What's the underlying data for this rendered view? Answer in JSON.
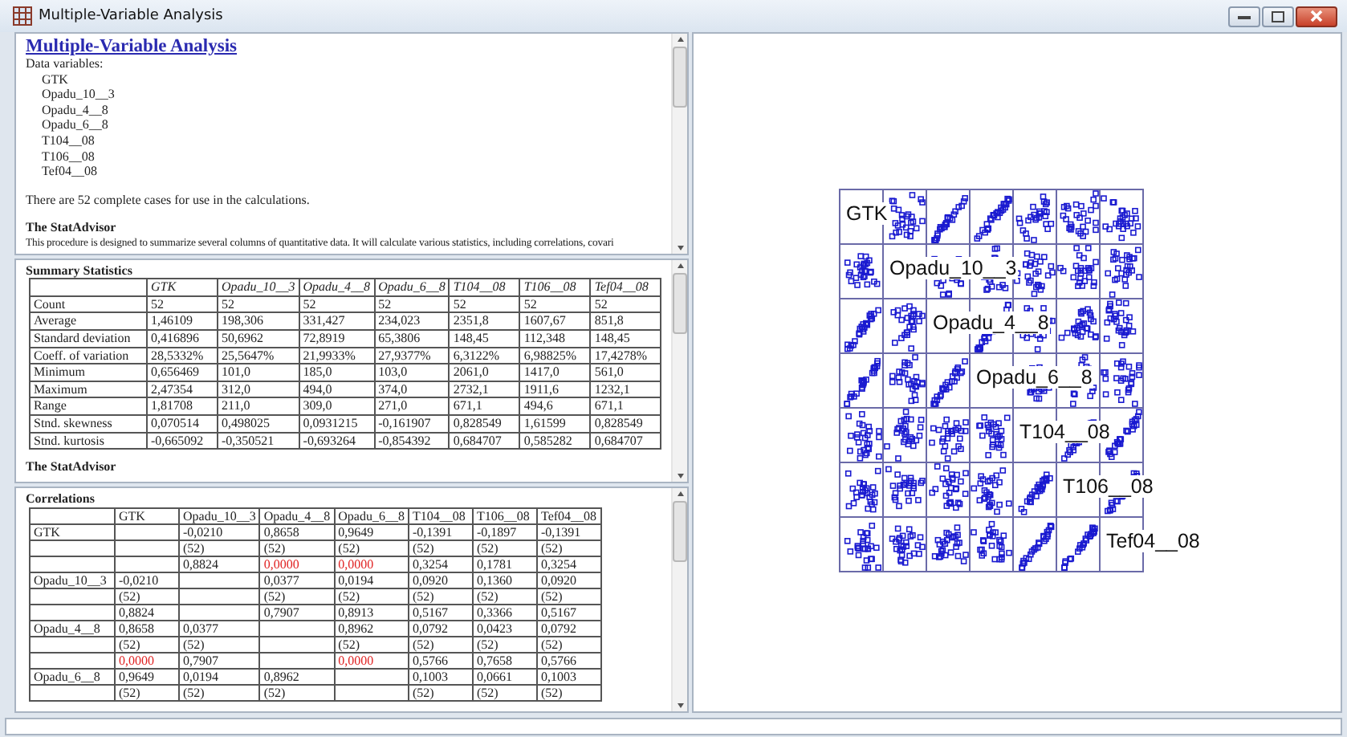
{
  "window": {
    "title": "Multiple-Variable Analysis"
  },
  "summary_pane": {
    "title": "Multiple-Variable Analysis",
    "variables_label": "Data variables:",
    "variables": [
      "GTK",
      "Opadu_10__3",
      "Opadu_4__8",
      "Opadu_6__8",
      "T104__08",
      "T106__08",
      "Tef04__08"
    ],
    "cases_text": "There are 52 complete cases for use in the calculations.",
    "advisor_title": "The StatAdvisor",
    "advisor_text": "This procedure is designed to summarize several columns of quantitative data.  It will calculate various statistics, including correlations, covari"
  },
  "stats_pane": {
    "title": "Summary Statistics",
    "columns": [
      "GTK",
      "Opadu_10__3",
      "Opadu_4__8",
      "Opadu_6__8",
      "T104__08",
      "T106__08",
      "Tef04__08"
    ],
    "rows": [
      {
        "label": "Count",
        "cells": [
          "52",
          "52",
          "52",
          "52",
          "52",
          "52",
          "52"
        ]
      },
      {
        "label": "Average",
        "cells": [
          "1,46109",
          "198,306",
          "331,427",
          "234,023",
          "2351,8",
          "1607,67",
          "851,8"
        ]
      },
      {
        "label": "Standard deviation",
        "cells": [
          "0,416896",
          "50,6962",
          "72,8919",
          "65,3806",
          "148,45",
          "112,348",
          "148,45"
        ]
      },
      {
        "label": "Coeff. of variation",
        "cells": [
          "28,5332%",
          "25,5647%",
          "21,9933%",
          "27,9377%",
          "6,3122%",
          "6,98825%",
          "17,4278%"
        ]
      },
      {
        "label": "Minimum",
        "cells": [
          "0,656469",
          "101,0",
          "185,0",
          "103,0",
          "2061,0",
          "1417,0",
          "561,0"
        ]
      },
      {
        "label": "Maximum",
        "cells": [
          "2,47354",
          "312,0",
          "494,0",
          "374,0",
          "2732,1",
          "1911,6",
          "1232,1"
        ]
      },
      {
        "label": "Range",
        "cells": [
          "1,81708",
          "211,0",
          "309,0",
          "271,0",
          "671,1",
          "494,6",
          "671,1"
        ]
      },
      {
        "label": "Stnd. skewness",
        "cells": [
          "0,070514",
          "0,498025",
          "0,0931215",
          "-0,161907",
          "0,828549",
          "1,61599",
          "0,828549"
        ]
      },
      {
        "label": "Stnd. kurtosis",
        "cells": [
          "-0,665092",
          "-0,350521",
          "-0,693264",
          "-0,854392",
          "0,684707",
          "0,585282",
          "0,684707"
        ]
      }
    ],
    "advisor_title": "The StatAdvisor"
  },
  "correlations_pane": {
    "title": "Correlations",
    "columns": [
      "GTK",
      "Opadu_10__3",
      "Opadu_4__8",
      "Opadu_6__8",
      "T104__08",
      "T106__08",
      "Tef04__08"
    ],
    "rows": [
      {
        "label": "GTK",
        "cells": [
          null,
          "-0,0210",
          "0,8658",
          "0,9649",
          "-0,1391",
          "-0,1897",
          "-0,1391"
        ]
      },
      {
        "cells": [
          null,
          "(52)",
          "(52)",
          "(52)",
          "(52)",
          "(52)",
          "(52)"
        ]
      },
      {
        "cells": [
          null,
          {
            "text": "0,8824",
            "significant": false
          },
          {
            "text": "0,0000",
            "significant": true
          },
          {
            "text": "0,0000",
            "significant": true
          },
          {
            "text": "0,3254",
            "significant": false
          },
          {
            "text": "0,1781",
            "significant": false
          },
          {
            "text": "0,3254",
            "significant": false
          }
        ]
      },
      {
        "label": "Opadu_10__3",
        "cells": [
          "-0,0210",
          null,
          "0,0377",
          "0,0194",
          "0,0920",
          "0,1360",
          "0,0920"
        ]
      },
      {
        "cells": [
          "(52)",
          null,
          "(52)",
          "(52)",
          "(52)",
          "(52)",
          "(52)"
        ]
      },
      {
        "cells": [
          {
            "text": "0,8824",
            "significant": false
          },
          null,
          {
            "text": "0,7907",
            "significant": false
          },
          {
            "text": "0,8913",
            "significant": false
          },
          {
            "text": "0,5167",
            "significant": false
          },
          {
            "text": "0,3366",
            "significant": false
          },
          {
            "text": "0,5167",
            "significant": false
          }
        ]
      },
      {
        "label": "Opadu_4__8",
        "cells": [
          "0,8658",
          "0,0377",
          null,
          "0,8962",
          "0,0792",
          "0,0423",
          "0,0792"
        ]
      },
      {
        "cells": [
          "(52)",
          "(52)",
          null,
          "(52)",
          "(52)",
          "(52)",
          "(52)"
        ]
      },
      {
        "cells": [
          {
            "text": "0,0000",
            "significant": true
          },
          {
            "text": "0,7907",
            "significant": false
          },
          null,
          {
            "text": "0,0000",
            "significant": true
          },
          {
            "text": "0,5766",
            "significant": false
          },
          {
            "text": "0,7658",
            "significant": false
          },
          {
            "text": "0,5766",
            "significant": false
          }
        ]
      },
      {
        "label": "Opadu_6__8",
        "cells": [
          "0,9649",
          "0,0194",
          "0,8962",
          null,
          "0,1003",
          "0,0661",
          "0,1003"
        ]
      },
      {
        "cells": [
          "(52)",
          "(52)",
          "(52)",
          null,
          "(52)",
          "(52)",
          "(52)"
        ]
      }
    ]
  },
  "matrix": {
    "labels": [
      "GTK",
      "Opadu_10__3",
      "Opadu_4__8",
      "Opadu_6__8",
      "T104__08",
      "T106__08",
      "Tef04__08"
    ]
  }
}
